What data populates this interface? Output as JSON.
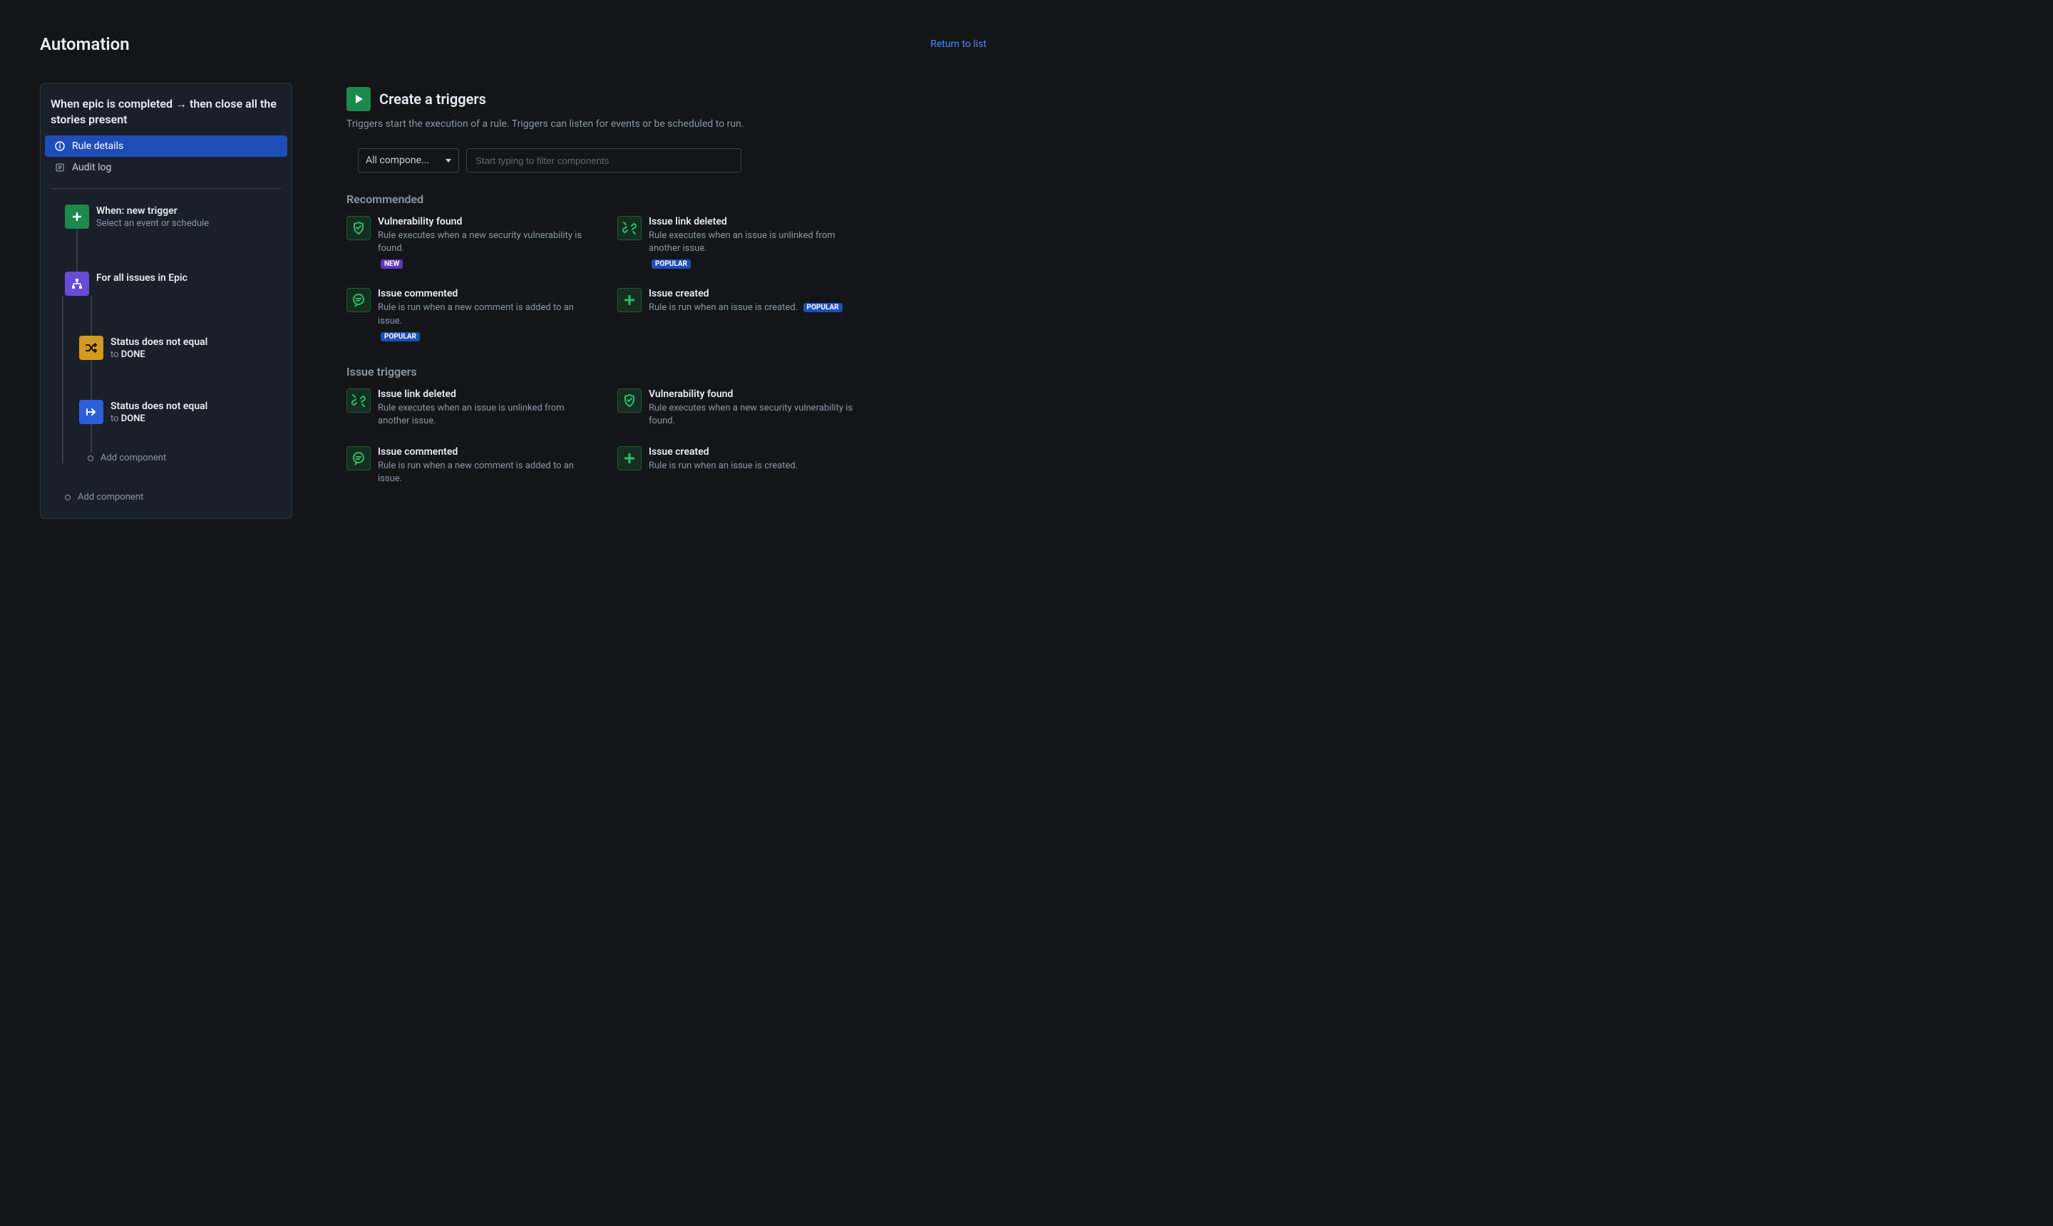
{
  "header": {
    "title": "Automation",
    "return_link": "Return to list"
  },
  "sidebar": {
    "rule_title": "When epic is completed → then close all the stories present",
    "nav": {
      "rule_details": "Rule details",
      "audit_log": "Audit log"
    },
    "tree": {
      "trigger": {
        "title": "When: new trigger",
        "sub": "Select an event or schedule"
      },
      "branch": {
        "title": "For all issues in Epic"
      },
      "cond1": {
        "title": "Status does not equal",
        "sub_prefix": "to ",
        "sub_value": "DONE"
      },
      "cond2": {
        "title": "Status does not equal",
        "sub_prefix": "to ",
        "sub_value": "DONE"
      },
      "add_inner": "Add component",
      "add_outer": "Add component"
    }
  },
  "main": {
    "title": "Create a triggers",
    "subtitle": "Triggers start the execution of a rule. Triggers can listen for events or be scheduled to run.",
    "filter": {
      "select_label": "All compone...",
      "search_placeholder": "Start typing to filter components"
    },
    "sections": {
      "recommended": "Recommended",
      "issue_triggers": "Issue triggers"
    },
    "badges": {
      "new": "NEW",
      "popular": "POPULAR"
    },
    "recommended": [
      {
        "title": "Vulnerability found",
        "desc": "Rule executes when a new security vulnerability is found.",
        "icon": "shield",
        "badge": "new"
      },
      {
        "title": "Issue link deleted",
        "desc": "Rule executes when an issue is unlinked from another issue.",
        "icon": "unlink",
        "badge": "popular"
      },
      {
        "title": "Issue commented",
        "desc": "Rule is run when a new comment is added to an issue.",
        "icon": "comment",
        "badge": "popular"
      },
      {
        "title": "Issue created",
        "desc": "Rule is run when an issue is created.",
        "icon": "plus",
        "badge": "popular"
      }
    ],
    "issue_triggers": [
      {
        "title": "Issue link deleted",
        "desc": "Rule executes when an issue is unlinked from another issue.",
        "icon": "unlink"
      },
      {
        "title": "Vulnerability found",
        "desc": "Rule executes when a new security vulnerability is found.",
        "icon": "shield"
      },
      {
        "title": "Issue commented",
        "desc": "Rule is run when a new comment is added to an issue.",
        "icon": "comment"
      },
      {
        "title": "Issue created",
        "desc": "Rule is run when an issue is created.",
        "icon": "plus"
      }
    ]
  }
}
